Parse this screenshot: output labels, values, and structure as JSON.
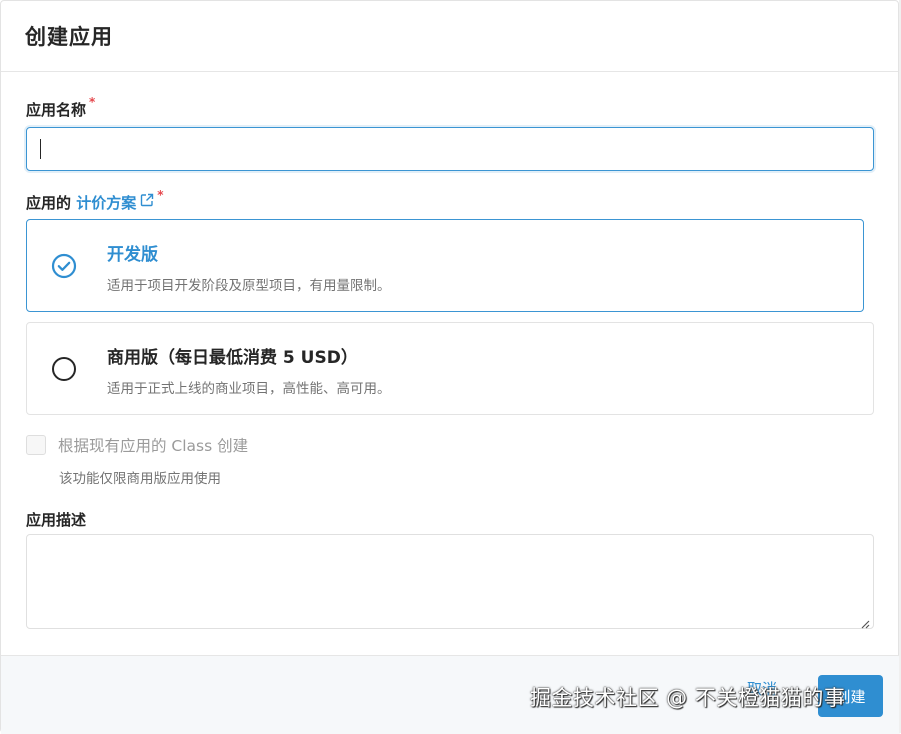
{
  "modal": {
    "title": "创建应用"
  },
  "name_field": {
    "label": "应用名称",
    "required_mark": "*",
    "value": "",
    "placeholder": ""
  },
  "plan_field": {
    "label_prefix": "应用的 ",
    "link_text": "计价方案",
    "link_icon": "external-link-icon",
    "required_mark": "*",
    "options": [
      {
        "title": "开发版",
        "description": "适用于项目开发阶段及原型项目，有用量限制。",
        "selected": true
      },
      {
        "title": "商用版（每日最低消费 5 USD）",
        "description": "适用于正式上线的商业项目，高性能、高可用。",
        "selected": false
      }
    ]
  },
  "class_option": {
    "label": "根据现有应用的 Class 创建",
    "hint": "该功能仅限商用版应用使用",
    "checked": false,
    "disabled": true
  },
  "description_field": {
    "label": "应用描述",
    "value": ""
  },
  "footer": {
    "cancel_label": "取消",
    "create_label": "创建"
  },
  "watermark": {
    "text": "掘金技术社区 @ 不关橙猫猫的事"
  },
  "colors": {
    "accent": "#2f8ed1",
    "required": "#e5484d",
    "footer_bg": "#f6f8fa"
  }
}
